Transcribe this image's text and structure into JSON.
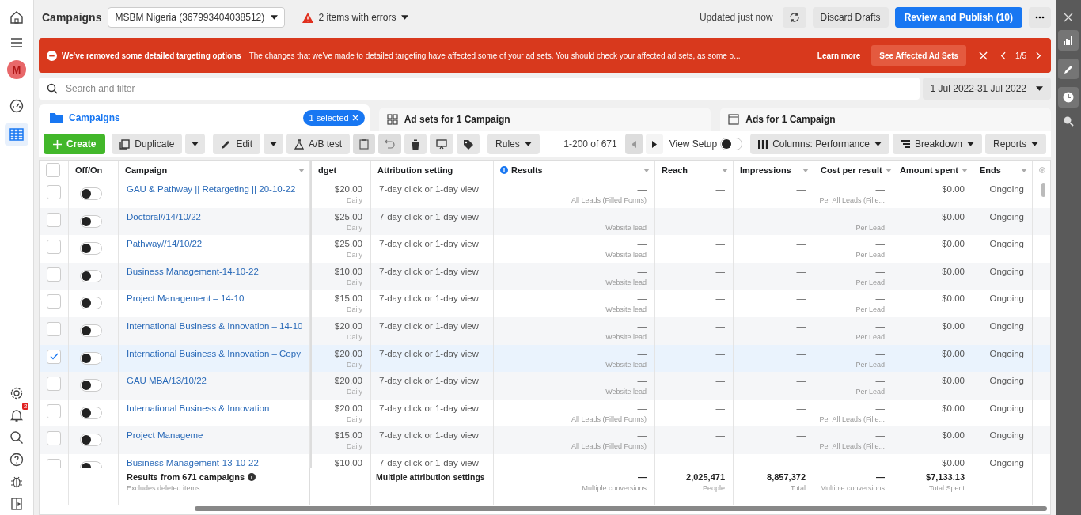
{
  "left_rail": {
    "avatar": "M",
    "notification_count": "2"
  },
  "top_bar": {
    "title": "Campaigns",
    "account": "MSBM Nigeria (367993404038512)",
    "errors": "2 items with errors",
    "updated": "Updated just now",
    "discard": "Discard Drafts",
    "publish": "Review and Publish (10)"
  },
  "banner": {
    "title": "We've removed some detailed targeting options",
    "message": "The changes that we've made to detailed targeting have affected some of your ad sets. You should check your affected ad sets, as some o...",
    "learn_more": "Learn more",
    "button": "See Affected Ad Sets",
    "pager": "1/5"
  },
  "search": {
    "placeholder": "Search and filter",
    "date_range": "1 Jul 2022-31 Jul 2022"
  },
  "tabs": [
    {
      "label": "Campaigns",
      "selected": true,
      "badge": "1 selected"
    },
    {
      "label": "Ad sets for 1 Campaign",
      "selected": false
    },
    {
      "label": "Ads for 1 Campaign",
      "selected": false
    }
  ],
  "toolbar": {
    "create": "Create",
    "duplicate": "Duplicate",
    "edit": "Edit",
    "ab_test": "A/B test",
    "rules": "Rules",
    "range": "1-200 of 671",
    "view_setup": "View Setup",
    "view_setup_on": false,
    "columns": "Columns: Performance",
    "breakdown": "Breakdown",
    "reports": "Reports"
  },
  "table": {
    "all_checked": false,
    "columns": [
      "Off/On",
      "Campaign",
      "dget",
      "Attribution setting",
      "Results",
      "Reach",
      "Impressions",
      "Cost per result",
      "Amount spent",
      "Ends"
    ],
    "rows": [
      {
        "checked": false,
        "on": false,
        "campaign": "GAU & Pathway || Retargeting || 20-10-22",
        "budget": "$20.00",
        "period": "Daily",
        "attribution": "7-day click or 1-day view",
        "results": "—",
        "results_type": "All Leads (Filled Forms)",
        "reach": "—",
        "impressions": "—",
        "cost": "—",
        "cost_type": "Per All Leads (Fille...",
        "spent": "$0.00",
        "ends": "Ongoing"
      },
      {
        "checked": false,
        "on": false,
        "campaign": "Doctoral//14/10/22 –",
        "budget": "$25.00",
        "period": "Daily",
        "attribution": "7-day click or 1-day view",
        "results": "—",
        "results_type": "Website lead",
        "reach": "—",
        "impressions": "—",
        "cost": "—",
        "cost_type": "Per Lead",
        "spent": "$0.00",
        "ends": "Ongoing"
      },
      {
        "checked": false,
        "on": false,
        "campaign": "Pathway//14/10/22",
        "budget": "$25.00",
        "period": "Daily",
        "attribution": "7-day click or 1-day view",
        "results": "—",
        "results_type": "Website lead",
        "reach": "—",
        "impressions": "—",
        "cost": "—",
        "cost_type": "Per Lead",
        "spent": "$0.00",
        "ends": "Ongoing"
      },
      {
        "checked": false,
        "on": false,
        "campaign": "Business Management-14-10-22",
        "budget": "$10.00",
        "period": "Daily",
        "attribution": "7-day click or 1-day view",
        "results": "—",
        "results_type": "Website lead",
        "reach": "—",
        "impressions": "—",
        "cost": "—",
        "cost_type": "Per Lead",
        "spent": "$0.00",
        "ends": "Ongoing"
      },
      {
        "checked": false,
        "on": false,
        "campaign": "Project Management – 14-10",
        "budget": "$15.00",
        "period": "Daily",
        "attribution": "7-day click or 1-day view",
        "results": "—",
        "results_type": "Website lead",
        "reach": "—",
        "impressions": "—",
        "cost": "—",
        "cost_type": "Per Lead",
        "spent": "$0.00",
        "ends": "Ongoing"
      },
      {
        "checked": false,
        "on": false,
        "campaign": "International Business & Innovation – 14-10",
        "budget": "$20.00",
        "period": "Daily",
        "attribution": "7-day click or 1-day view",
        "results": "—",
        "results_type": "Website lead",
        "reach": "—",
        "impressions": "—",
        "cost": "—",
        "cost_type": "Per Lead",
        "spent": "$0.00",
        "ends": "Ongoing"
      },
      {
        "checked": true,
        "on": false,
        "campaign": "International Business & Innovation – Copy",
        "budget": "$20.00",
        "period": "Daily",
        "attribution": "7-day click or 1-day view",
        "results": "—",
        "results_type": "Website lead",
        "reach": "—",
        "impressions": "—",
        "cost": "—",
        "cost_type": "Per Lead",
        "spent": "$0.00",
        "ends": "Ongoing"
      },
      {
        "checked": false,
        "on": false,
        "campaign": "GAU MBA/13/10/22",
        "budget": "$20.00",
        "period": "Daily",
        "attribution": "7-day click or 1-day view",
        "results": "—",
        "results_type": "Website lead",
        "reach": "—",
        "impressions": "—",
        "cost": "—",
        "cost_type": "Per Lead",
        "spent": "$0.00",
        "ends": "Ongoing"
      },
      {
        "checked": false,
        "on": false,
        "campaign": "International Business & Innovation",
        "budget": "$20.00",
        "period": "Daily",
        "attribution": "7-day click or 1-day view",
        "results": "—",
        "results_type": "All Leads (Filled Forms)",
        "reach": "—",
        "impressions": "—",
        "cost": "—",
        "cost_type": "Per All Leads (Fille...",
        "spent": "$0.00",
        "ends": "Ongoing"
      },
      {
        "checked": false,
        "on": false,
        "campaign": "Project Manageme",
        "budget": "$15.00",
        "period": "Daily",
        "attribution": "7-day click or 1-day view",
        "results": "—",
        "results_type": "All Leads (Filled Forms)",
        "reach": "—",
        "impressions": "—",
        "cost": "—",
        "cost_type": "Per All Leads (Fille...",
        "spent": "$0.00",
        "ends": "Ongoing"
      },
      {
        "checked": false,
        "on": false,
        "campaign": "Business Management-13-10-22",
        "budget": "$10.00",
        "attribution": "7-day click or 1-day view",
        "results": "—",
        "reach": "—",
        "impressions": "—",
        "cost": "—",
        "spent": "$0.00",
        "ends": "Ongoing"
      }
    ],
    "footer": {
      "title": "Results from 671 campaigns",
      "note": "Excludes deleted items",
      "attribution": "Multiple attribution settings",
      "results": "—",
      "results_type": "Multiple conversions",
      "reach": "2,025,471",
      "reach_type": "People",
      "impressions": "8,857,372",
      "impressions_type": "Total",
      "cost": "—",
      "cost_type": "Multiple conversions",
      "spent": "$7,133.13",
      "spent_type": "Total Spent"
    }
  }
}
